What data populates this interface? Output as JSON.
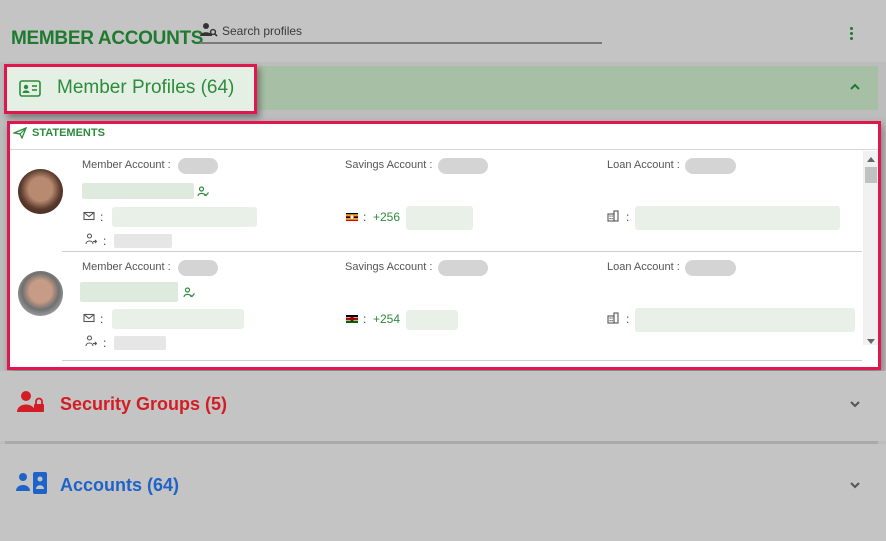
{
  "header": {
    "title": "MEMBER ACCOUNTS",
    "search_placeholder": "Search profiles"
  },
  "profiles_panel": {
    "label": "Member Profiles (64)",
    "expanded": true
  },
  "statements": {
    "label": "STATEMENTS",
    "field_labels": {
      "member_account": "Member Account :",
      "savings_account": "Savings Account :",
      "loan_account": "Loan Account :"
    },
    "colon": ":",
    "members": [
      {
        "phone_prefix": "+256",
        "flag": "uganda-flag-icon"
      },
      {
        "phone_prefix": "+254",
        "flag": "kenya-flag-icon"
      }
    ]
  },
  "security_panel": {
    "label": "Security Groups (5)"
  },
  "accounts_panel": {
    "label": "Accounts (64)"
  },
  "colors": {
    "green": "#2e8b3c",
    "red": "#d41c24",
    "blue": "#1f63c8",
    "highlight": "#e0174f"
  }
}
